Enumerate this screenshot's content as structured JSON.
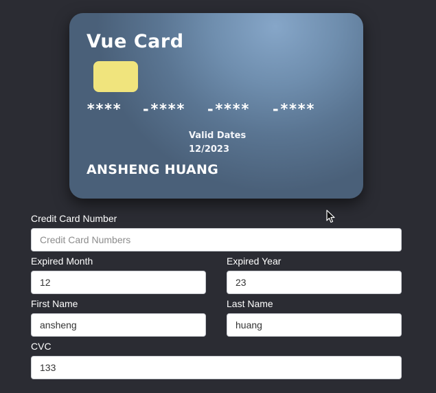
{
  "card": {
    "title": "Vue Card",
    "number_groups": [
      "****",
      "-****",
      "-****",
      "-****"
    ],
    "valid_label": "Valid Dates",
    "valid_value": "12/2023",
    "holder": "ANSHENG HUANG",
    "chip_color": "#f0e47d"
  },
  "form": {
    "card_number": {
      "label": "Credit Card Number",
      "value": "",
      "placeholder": "Credit Card Numbers"
    },
    "expired_month": {
      "label": "Expired Month",
      "value": "12"
    },
    "expired_year": {
      "label": "Expired Year",
      "value": "23"
    },
    "first_name": {
      "label": "First Name",
      "value": "ansheng"
    },
    "last_name": {
      "label": "Last Name",
      "value": "huang"
    },
    "cvc": {
      "label": "CVC",
      "value": "133"
    }
  },
  "theme": {
    "background": "#2b2c33",
    "text": "#ffffff"
  },
  "cursor": {
    "icon": "mouse-pointer-icon"
  }
}
